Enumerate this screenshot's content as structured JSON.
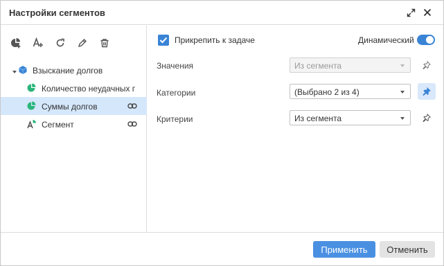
{
  "dialog": {
    "title": "Настройки сегментов",
    "icons": {
      "expand": "expand-icon",
      "close": "close-icon"
    }
  },
  "toolbar": {
    "icons": [
      "add-segment-icon",
      "add-text-segment-icon",
      "refresh-icon",
      "edit-icon",
      "delete-icon"
    ]
  },
  "tree": {
    "root": {
      "label": "Взыскание долгов",
      "icon": "cube-icon",
      "expanded": true
    },
    "items": [
      {
        "label": "Количество неудачных п...",
        "icon": "pie-chart-icon",
        "linked": false,
        "selected": false
      },
      {
        "label": "Суммы долгов",
        "icon": "pie-chart-icon",
        "linked": true,
        "selected": true
      },
      {
        "label": "Сегмент",
        "icon": "text-segment-icon",
        "linked": true,
        "selected": false
      }
    ]
  },
  "settings": {
    "attach_label": "Прикрепить к задаче",
    "attach_checked": true,
    "dynamic_label": "Динамический",
    "dynamic_on": true,
    "fields": [
      {
        "label": "Значения",
        "value": "Из сегмента",
        "disabled": true,
        "pinned": false
      },
      {
        "label": "Категории",
        "value": "(Выбрано 2 из 4)",
        "disabled": false,
        "pinned": true
      },
      {
        "label": "Критерии",
        "value": "Из сегмента",
        "disabled": false,
        "pinned": false
      }
    ]
  },
  "footer": {
    "apply_label": "Применить",
    "cancel_label": "Отменить"
  },
  "colors": {
    "accent": "#3a84d6",
    "primary_button": "#4a90e2",
    "selection": "#d5e7fb",
    "segment_green": "#2bb57a",
    "cube_blue": "#3a84d6"
  }
}
